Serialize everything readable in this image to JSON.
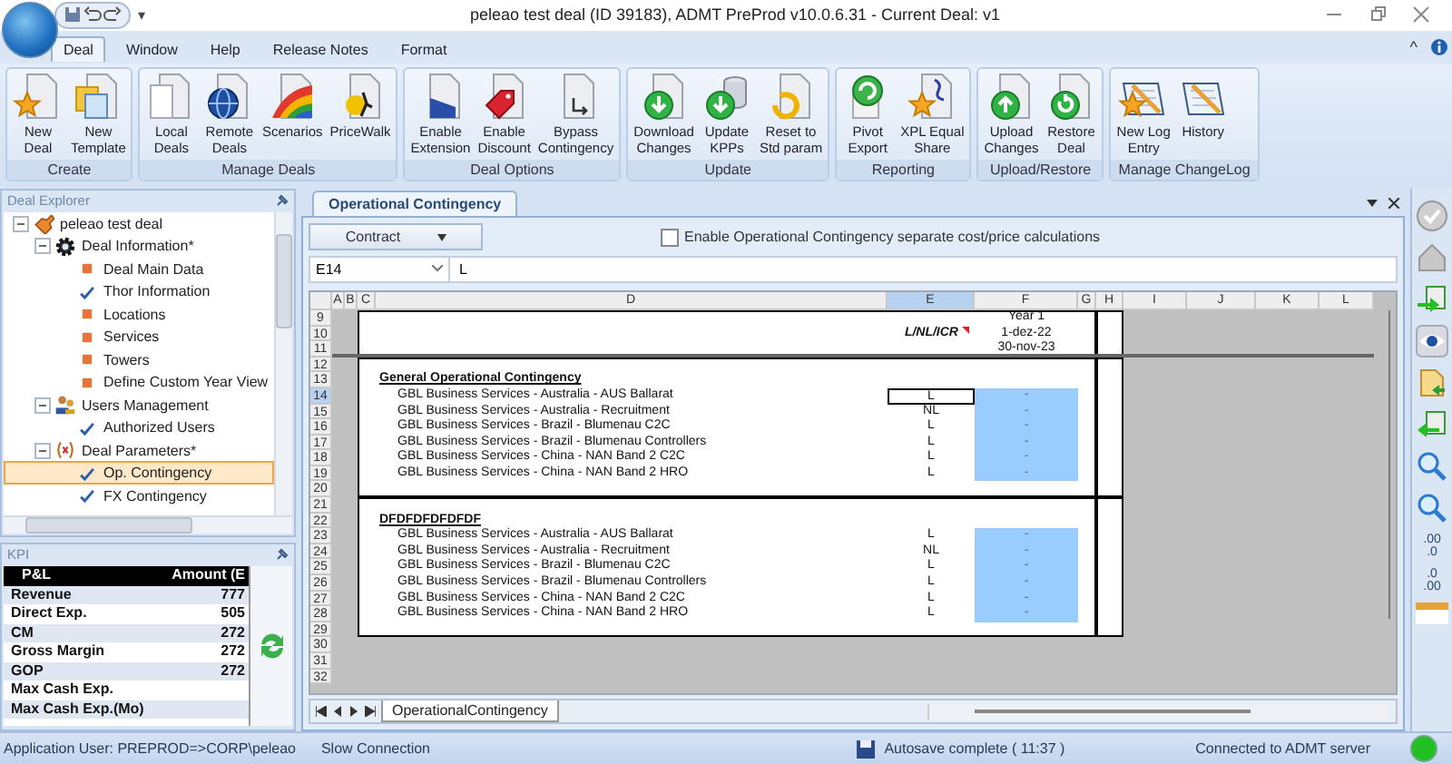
{
  "window": {
    "title": "peleao test deal (ID 39183), ADMT PreProd v10.0.6.31 - Current Deal: v1",
    "quick_access_menu": "▾"
  },
  "ribbon": {
    "tabs": [
      {
        "label": "Deal",
        "selected": true
      },
      {
        "label": "Window",
        "selected": false
      },
      {
        "label": "Help",
        "selected": false
      },
      {
        "label": "Release Notes",
        "selected": false
      },
      {
        "label": "Format",
        "selected": false
      }
    ],
    "collapse": "^",
    "groups": [
      {
        "label": "Create",
        "buttons": [
          {
            "lines": [
              "New",
              "Deal"
            ]
          },
          {
            "lines": [
              "New",
              "Template"
            ]
          }
        ]
      },
      {
        "label": "Manage Deals",
        "buttons": [
          {
            "lines": [
              "Local",
              "Deals"
            ]
          },
          {
            "lines": [
              "Remote",
              "Deals"
            ]
          },
          {
            "lines": [
              "Scenarios"
            ]
          },
          {
            "lines": [
              "PriceWalk"
            ]
          }
        ]
      },
      {
        "label": "Deal Options",
        "buttons": [
          {
            "lines": [
              "Enable",
              "Extension"
            ]
          },
          {
            "lines": [
              "Enable",
              "Discount"
            ]
          },
          {
            "lines": [
              "Bypass",
              "Contingency"
            ]
          }
        ]
      },
      {
        "label": "Update",
        "buttons": [
          {
            "lines": [
              "Download",
              "Changes"
            ]
          },
          {
            "lines": [
              "Update",
              "KPPs"
            ]
          },
          {
            "lines": [
              "Reset to",
              "Std param"
            ]
          }
        ]
      },
      {
        "label": "Reporting",
        "buttons": [
          {
            "lines": [
              "Pivot",
              "Export"
            ]
          },
          {
            "lines": [
              "XPL Equal",
              "Share"
            ]
          }
        ]
      },
      {
        "label": "Upload/Restore",
        "buttons": [
          {
            "lines": [
              "Upload",
              "Changes"
            ]
          },
          {
            "lines": [
              "Restore",
              "Deal"
            ]
          }
        ]
      },
      {
        "label": "Manage ChangeLog",
        "buttons": [
          {
            "lines": [
              "New Log",
              "Entry"
            ]
          },
          {
            "lines": [
              "History"
            ]
          }
        ]
      }
    ]
  },
  "deal_explorer": {
    "title": "Deal Explorer",
    "tree": [
      {
        "label": "peleao test deal",
        "kind": "deal",
        "expanded": true,
        "selected": false,
        "children": [
          {
            "label": "Deal Information*",
            "kind": "gear",
            "expanded": true,
            "selected": false,
            "children": [
              {
                "label": "Deal Main Data",
                "kind": "pending",
                "selected": false
              },
              {
                "label": "Thor Information",
                "kind": "done",
                "selected": false
              },
              {
                "label": "Locations",
                "kind": "pending",
                "selected": false
              },
              {
                "label": "Services",
                "kind": "pending",
                "selected": false
              },
              {
                "label": "Towers",
                "kind": "pending",
                "selected": false
              },
              {
                "label": "Define Custom Year View",
                "kind": "pending",
                "selected": false
              }
            ]
          },
          {
            "label": "Users Management",
            "kind": "users",
            "expanded": true,
            "selected": false,
            "children": [
              {
                "label": "Authorized Users",
                "kind": "done",
                "selected": false
              }
            ]
          },
          {
            "label": "Deal Parameters*",
            "kind": "formula",
            "expanded": true,
            "selected": false,
            "children": [
              {
                "label": "Op. Contingency",
                "kind": "done",
                "selected": true
              },
              {
                "label": "FX Contingency",
                "kind": "done",
                "selected": false
              }
            ]
          }
        ]
      }
    ]
  },
  "kpi": {
    "title": "KPI",
    "columns": [
      "P&L",
      "Amount (E"
    ],
    "rows": [
      {
        "label": "Revenue",
        "amount": "777"
      },
      {
        "label": "Direct Exp.",
        "amount": "505"
      },
      {
        "label": "CM",
        "amount": "272"
      },
      {
        "label": "Gross Margin",
        "amount": "272"
      },
      {
        "label": "GOP",
        "amount": "272"
      },
      {
        "label": "Max Cash Exp.",
        "amount": ""
      },
      {
        "label": "Max Cash Exp.(Mo)",
        "amount": ""
      }
    ]
  },
  "document": {
    "tabs": [
      {
        "label": "Operational Contingency",
        "selected": true
      }
    ],
    "scenario_dropdown": {
      "value": "Contract"
    },
    "separate_calculations": {
      "label": "Enable Operational Contingency separate cost/price calculations",
      "checked": false
    },
    "name_box": "E14",
    "formula": "L",
    "sheet": {
      "columns": [
        {
          "label": "A",
          "selected": false
        },
        {
          "label": "B",
          "selected": false
        },
        {
          "label": "C",
          "selected": false
        },
        {
          "label": "D",
          "selected": false
        },
        {
          "label": "E",
          "selected": true
        },
        {
          "label": "F",
          "selected": false
        },
        {
          "label": "G",
          "selected": false
        },
        {
          "label": "H",
          "selected": false
        },
        {
          "label": "I",
          "selected": false
        },
        {
          "label": "J",
          "selected": false
        },
        {
          "label": "K",
          "selected": false
        },
        {
          "label": "L",
          "selected": false
        }
      ],
      "rows": [
        {
          "label": "9",
          "selected": false
        },
        {
          "label": "10",
          "selected": false
        },
        {
          "label": "11",
          "selected": false
        },
        {
          "label": "12",
          "selected": false
        },
        {
          "label": "13",
          "selected": false
        },
        {
          "label": "14",
          "selected": true
        },
        {
          "label": "15",
          "selected": false
        },
        {
          "label": "16",
          "selected": false
        },
        {
          "label": "17",
          "selected": false
        },
        {
          "label": "18",
          "selected": false
        },
        {
          "label": "19",
          "selected": false
        },
        {
          "label": "20",
          "selected": false
        },
        {
          "label": "21",
          "selected": false
        },
        {
          "label": "22",
          "selected": false
        },
        {
          "label": "23",
          "selected": false
        },
        {
          "label": "24",
          "selected": false
        },
        {
          "label": "25",
          "selected": false
        },
        {
          "label": "26",
          "selected": false
        },
        {
          "label": "27",
          "selected": false
        },
        {
          "label": "28",
          "selected": false
        },
        {
          "label": "29",
          "selected": false
        },
        {
          "label": "30",
          "selected": false
        },
        {
          "label": "31",
          "selected": false
        },
        {
          "label": "32",
          "selected": false
        }
      ],
      "header": {
        "type_label": "L/NL/ICR",
        "period": "Year 1",
        "start": "1-dez-22",
        "end": "30-nov-23"
      },
      "sections": [
        {
          "title": "General Operational Contingency",
          "items": [
            {
              "label": "GBL Business Services - Australia - AUS Ballarat",
              "type": "L",
              "amount": "-",
              "selected": true
            },
            {
              "label": "GBL Business Services - Australia - Recruitment",
              "type": "NL",
              "amount": "-",
              "selected": false
            },
            {
              "label": "GBL Business Services - Brazil - Blumenau C2C",
              "type": "L",
              "amount": "-",
              "selected": false
            },
            {
              "label": "GBL Business Services - Brazil - Blumenau Controllers",
              "type": "L",
              "amount": "-",
              "selected": false
            },
            {
              "label": "GBL Business Services - China - NAN Band 2 C2C",
              "type": "L",
              "amount": "-",
              "selected": false
            },
            {
              "label": "GBL Business Services - China - NAN Band 2 HRO",
              "type": "L",
              "amount": "-",
              "selected": false
            }
          ]
        },
        {
          "title": "DFDFDFDFDFDF",
          "items": [
            {
              "label": "GBL Business Services - Australia - AUS Ballarat",
              "type": "L",
              "amount": "-",
              "selected": false
            },
            {
              "label": "GBL Business Services - Australia - Recruitment",
              "type": "NL",
              "amount": "-",
              "selected": false
            },
            {
              "label": "GBL Business Services - Brazil - Blumenau C2C",
              "type": "L",
              "amount": "-",
              "selected": false
            },
            {
              "label": "GBL Business Services - Brazil - Blumenau Controllers",
              "type": "L",
              "amount": "-",
              "selected": false
            },
            {
              "label": "GBL Business Services - China - NAN Band 2 C2C",
              "type": "L",
              "amount": "-",
              "selected": false
            },
            {
              "label": "GBL Business Services - China - NAN Band 2 HRO",
              "type": "L",
              "amount": "-",
              "selected": false
            }
          ]
        }
      ],
      "sheet_tabs": [
        {
          "label": "OperationalContingency",
          "selected": true
        }
      ]
    }
  },
  "side_toolbar": {
    "decimal_buttons": [
      {
        "top": ".00",
        "bottom": ".0"
      },
      {
        "top": ".0",
        "bottom": ".00"
      }
    ]
  },
  "status_bar": {
    "user": "Application User: PREPROD=>CORP\\peleao",
    "connection_speed": "Slow Connection",
    "autosave": "Autosave complete ( 11:37 )",
    "server": "Connected to ADMT server",
    "connected": true
  }
}
